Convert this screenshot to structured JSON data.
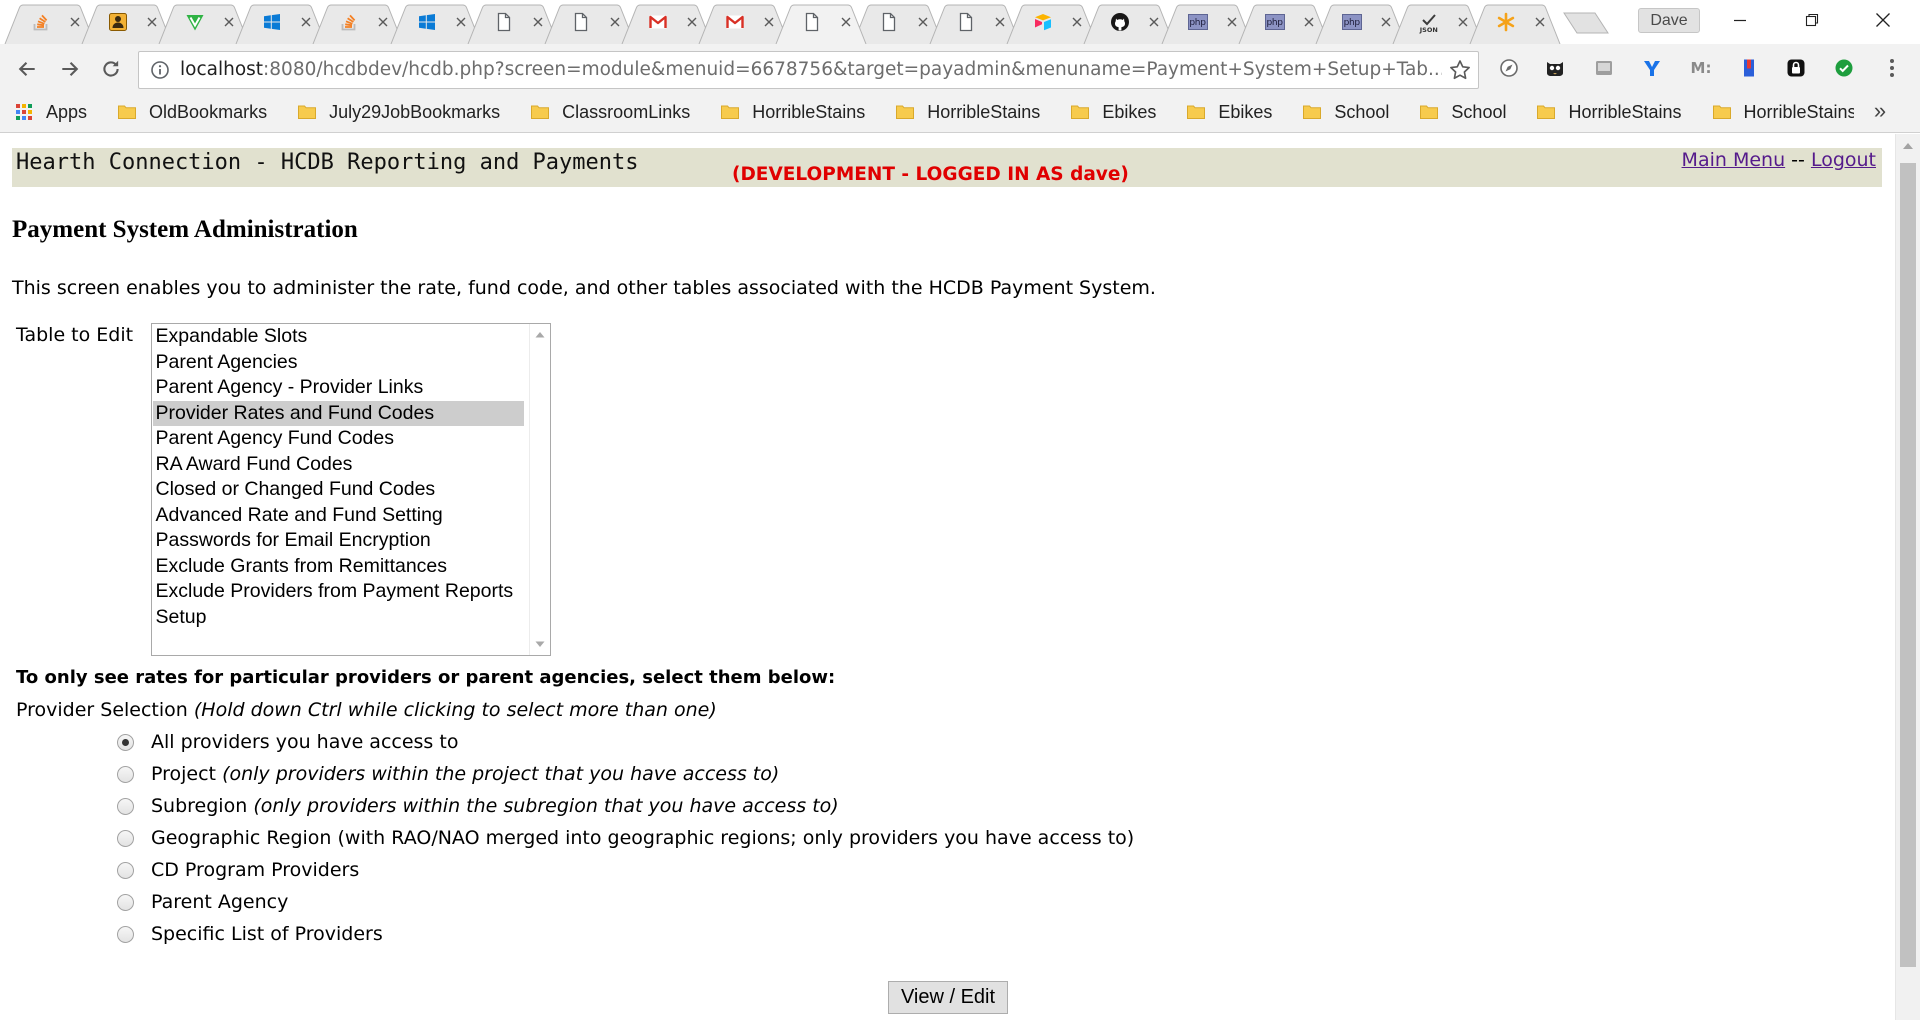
{
  "colors": {
    "frame": "#ffffff",
    "toolbar": "#f2f2f2",
    "header_band": "#e1e1cf",
    "dev_notice": "#e00000",
    "link": "#551a8b",
    "selected_option": "#cdcdcd"
  },
  "browser": {
    "tabs": [
      {
        "icon": "stackoverflow-icon"
      },
      {
        "icon": "badge-person-icon"
      },
      {
        "icon": "green-v-icon"
      },
      {
        "icon": "windows-icon"
      },
      {
        "icon": "stackoverflow-icon"
      },
      {
        "icon": "windows-icon"
      },
      {
        "icon": "page-icon"
      },
      {
        "icon": "page-icon"
      },
      {
        "icon": "gmail-icon"
      },
      {
        "icon": "gmail-icon"
      },
      {
        "icon": "page-icon"
      },
      {
        "icon": "page-icon"
      },
      {
        "icon": "page-icon"
      },
      {
        "icon": "airtable-icon"
      },
      {
        "icon": "github-icon"
      },
      {
        "icon": "php-icon",
        "icon_text": "php"
      },
      {
        "icon": "php-icon",
        "icon_text": "php"
      },
      {
        "icon": "php-icon",
        "icon_text": "php"
      },
      {
        "icon": "json-check-icon",
        "icon_text": "JSON"
      },
      {
        "icon": "asterisk-icon"
      }
    ],
    "active_tab_index": 10,
    "profile_name": "Dave",
    "address": {
      "host": "localhost",
      "rest": ":8080/hcdbdev/hcdb.php?screen=module&menuid=6678756&target=payadmin&menuname=Payment+System+Setup+Tab..."
    },
    "extensions": [
      {
        "icon": "compass-icon"
      },
      {
        "icon": "owl-icon"
      },
      {
        "icon": "grey-box-icon"
      },
      {
        "icon": "blue-y-icon"
      },
      {
        "icon": "m-extension-icon",
        "icon_text": "M:"
      },
      {
        "icon": "bookmark-ribbon-icon"
      },
      {
        "icon": "lock-icon"
      },
      {
        "icon": "check-circle-icon"
      }
    ],
    "bookmarks": {
      "apps_label": "Apps",
      "items": [
        "OldBookmarks",
        "July29JobBookmarks",
        "ClassroomLinks",
        "HorribleStains",
        "HorribleStains",
        "Ebikes",
        "Ebikes",
        "School",
        "School",
        "HorribleStains",
        "HorribleStains"
      ],
      "overflow_glyph": "»"
    }
  },
  "page": {
    "header": {
      "app_title": "Hearth Connection - HCDB Reporting and Payments",
      "dev_notice": "(DEVELOPMENT - LOGGED IN AS dave)",
      "main_menu_link": "Main Menu",
      "separator": "--",
      "logout_link": "Logout"
    },
    "title": "Payment System Administration",
    "description": "This screen enables you to administer the rate, fund code, and other tables associated with the HCDB Payment System.",
    "table_editor": {
      "label": "Table to Edit",
      "options": [
        "Expandable Slots",
        "Parent Agencies",
        "Parent Agency - Provider Links",
        "Provider Rates and Fund Codes",
        "Parent Agency Fund Codes",
        "RA Award Fund Codes",
        "Closed or Changed Fund Codes",
        "Advanced Rate and Fund Setting",
        "Passwords for Email Encryption",
        "Exclude Grants from Remittances",
        "Exclude Providers from Payment Reports",
        "Setup"
      ],
      "selected_index": 3
    },
    "filter": {
      "heading": "To only see rates for particular providers or parent agencies, select them below:",
      "provider_selection_label": "Provider Selection",
      "provider_selection_hint": "(Hold down Ctrl while clicking to select more than one)",
      "options": [
        {
          "label": "All providers you have access to",
          "hint": ""
        },
        {
          "label": "Project",
          "hint": "(only providers within the project that you have access to)"
        },
        {
          "label": "Subregion",
          "hint": "(only providers within the subregion that you have access to)"
        },
        {
          "label": "Geographic Region (with RAO/NAO merged into geographic regions; only providers you have access to)",
          "hint": ""
        },
        {
          "label": "CD Program Providers",
          "hint": ""
        },
        {
          "label": "Parent Agency",
          "hint": ""
        },
        {
          "label": "Specific List of Providers",
          "hint": ""
        }
      ],
      "selected_index": 0
    },
    "submit_label": "View / Edit"
  }
}
